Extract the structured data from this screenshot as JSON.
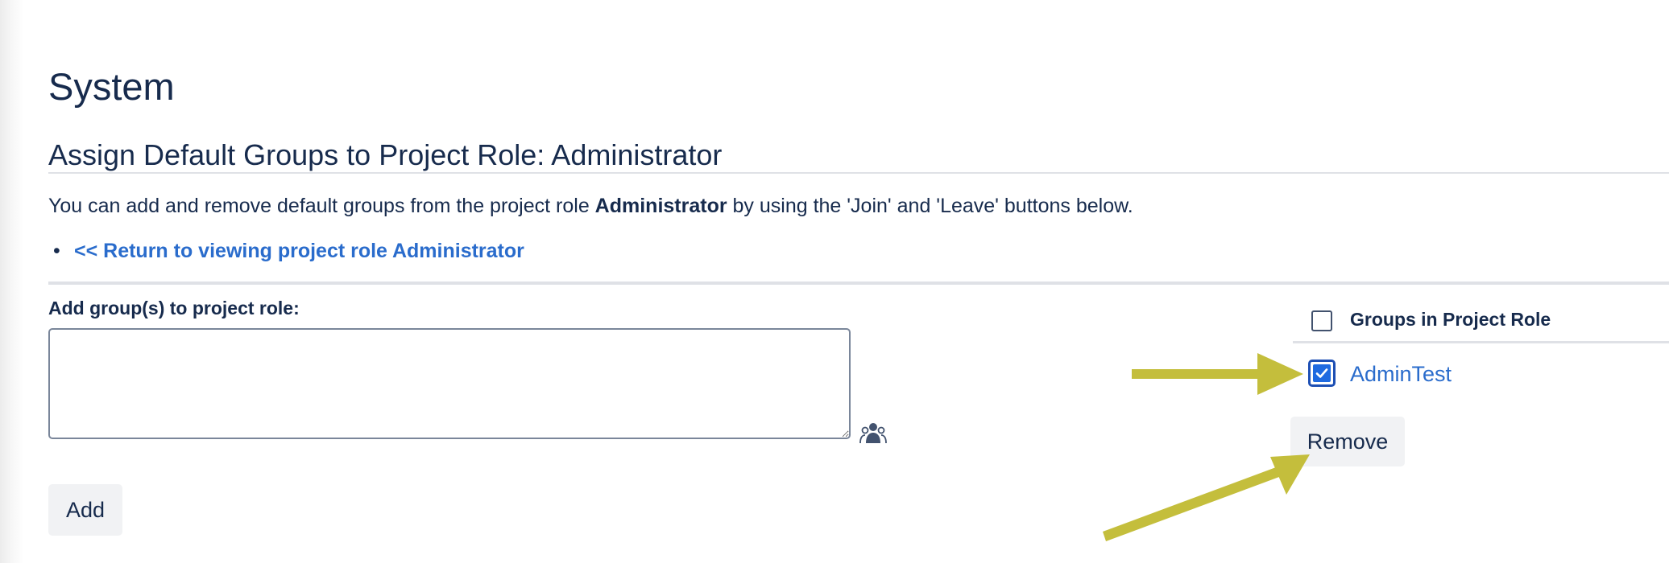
{
  "page": {
    "title": "System",
    "heading": "Assign Default Groups to Project Role: Administrator",
    "intro_before": "You can add and remove default groups from the project role ",
    "intro_role": "Administrator",
    "intro_after": " by using the 'Join' and 'Leave' buttons below.",
    "return_link": "<< Return to viewing project role Administrator"
  },
  "add_form": {
    "label": "Add group(s) to project role:",
    "textarea_value": "",
    "picker_icon": "group-picker-icon",
    "add_label": "Add"
  },
  "groups_panel": {
    "header_label": "Groups in Project Role",
    "select_all_checked": false,
    "groups": [
      {
        "name": "AdminTest",
        "checked": true
      }
    ],
    "remove_label": "Remove"
  },
  "colors": {
    "text": "#172b4d",
    "link": "#2a6ccc",
    "checkbox_checked": "#1f6ae0",
    "button_bg": "#f1f2f4",
    "annotation_arrow": "#c4be3c"
  }
}
